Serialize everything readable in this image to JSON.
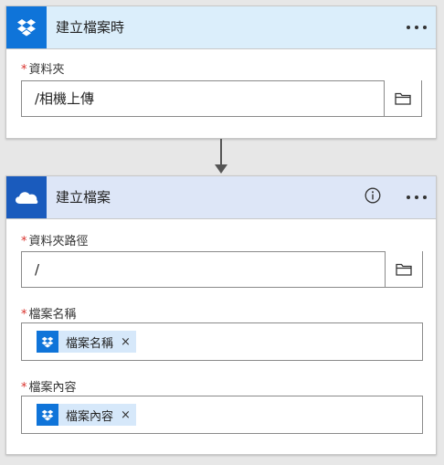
{
  "trigger": {
    "title": "建立檔案時",
    "folder_label": "資料夾",
    "folder_value": "/相機上傳"
  },
  "action": {
    "title": "建立檔案",
    "folder_path_label": "資料夾路徑",
    "folder_path_value": "/",
    "file_name_label": "檔案名稱",
    "file_name_token": "檔案名稱",
    "file_content_label": "檔案內容",
    "file_content_token": "檔案內容"
  },
  "required_marker": "*",
  "token_remove": "×",
  "icons": {
    "trigger": "dropbox-icon",
    "action": "onedrive-icon",
    "browse": "folder-icon",
    "info": "info-icon",
    "menu": "more-icon",
    "connector": "down-arrow-icon"
  },
  "colors": {
    "trigger_header": "#dbeefb",
    "trigger_icon_bg": "#0f74d9",
    "action_header": "#dde6f7",
    "action_icon_bg": "#1a5bbd",
    "token_bg": "#d6e8fa",
    "required": "#d9302b"
  }
}
